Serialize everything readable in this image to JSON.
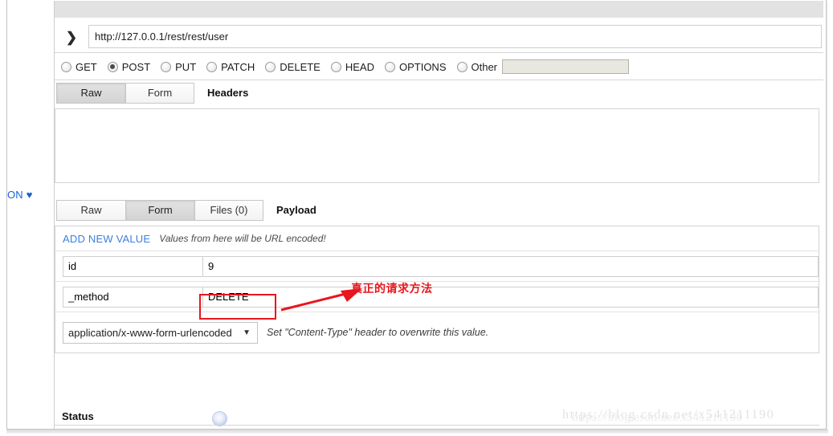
{
  "window": {
    "left_fragment_text": "ON",
    "left_fragment_heart": "♥"
  },
  "request": {
    "expand_icon": "❯",
    "url_value": "http://127.0.0.1/rest/rest/user",
    "url_placeholder": "http://",
    "methods": [
      {
        "label": "GET",
        "selected": false
      },
      {
        "label": "POST",
        "selected": true
      },
      {
        "label": "PUT",
        "selected": false
      },
      {
        "label": "PATCH",
        "selected": false
      },
      {
        "label": "DELETE",
        "selected": false
      },
      {
        "label": "HEAD",
        "selected": false
      },
      {
        "label": "OPTIONS",
        "selected": false
      },
      {
        "label": "Other",
        "selected": false
      }
    ],
    "other_value": "",
    "other_placeholder": ""
  },
  "headers": {
    "title": "Headers",
    "tabs": [
      {
        "label": "Raw",
        "active": true
      },
      {
        "label": "Form",
        "active": false
      }
    ],
    "textarea_value": "",
    "textarea_placeholder": ""
  },
  "payload": {
    "title": "Payload",
    "tabs": [
      {
        "label": "Raw",
        "active": false
      },
      {
        "label": "Form",
        "active": true
      },
      {
        "label": "Files (0)",
        "active": false
      }
    ],
    "add_new_value_label": "ADD NEW VALUE",
    "url_encode_hint": "Values from here will be URL encoded!",
    "rows": [
      {
        "key": "id",
        "value": "9"
      },
      {
        "key": "_method",
        "value": "DELETE"
      }
    ],
    "content_type": {
      "selected": "application/x-www-form-urlencoded",
      "arrow": "▼",
      "hint": "Set \"Content-Type\" header to overwrite this value."
    }
  },
  "status": {
    "label": "Status"
  },
  "annotations": {
    "highlight_note": "真正的请求方法",
    "highlight_color": "#e8161d"
  },
  "watermark": {
    "text": "https://blog.csdn.net/x541211190"
  }
}
